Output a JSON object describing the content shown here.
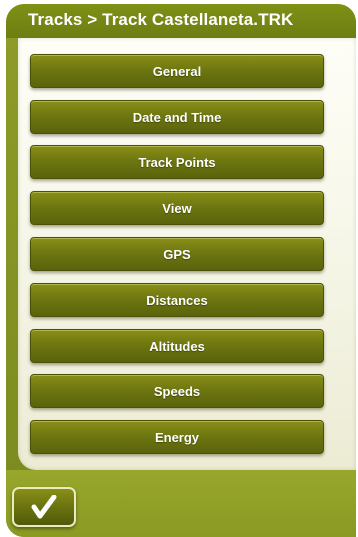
{
  "header": {
    "title": "Tracks > Track Castellaneta.TRK"
  },
  "menu": {
    "items": [
      {
        "label": "General"
      },
      {
        "label": "Date and Time"
      },
      {
        "label": "Track Points"
      },
      {
        "label": "View"
      },
      {
        "label": "GPS"
      },
      {
        "label": "Distances"
      },
      {
        "label": "Altitudes"
      },
      {
        "label": "Speeds"
      },
      {
        "label": "Energy"
      }
    ]
  },
  "footer": {
    "ok_icon": "checkmark-icon"
  },
  "colors": {
    "accent": "#7a8a1f",
    "button": "#6e7710",
    "panel": "#f4f4e4"
  }
}
